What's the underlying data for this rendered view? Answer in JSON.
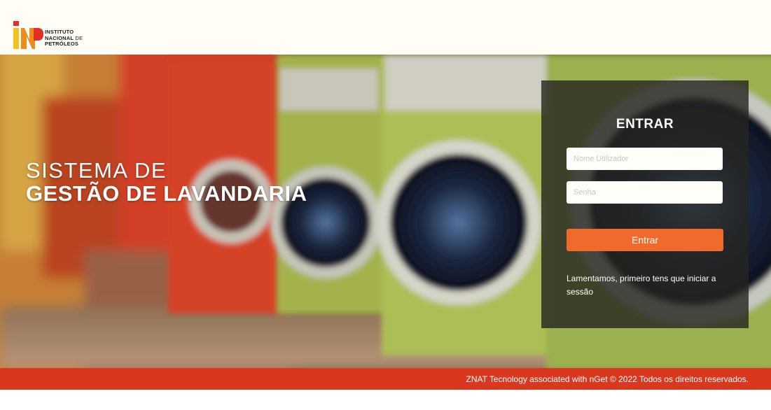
{
  "brand": {
    "line1": "INSTITUTO",
    "line2_bold": "NACIONAL",
    "line2_light": "DE",
    "line3": "PETRÓLEOS"
  },
  "hero": {
    "line1": "SISTEMA DE",
    "line2": "GESTÃO DE LAVANDARIA"
  },
  "login": {
    "title": "ENTRAR",
    "username_placeholder": "Nome Utilizador",
    "username_value": "",
    "password_placeholder": "Senha",
    "password_value": "",
    "submit_label": "Entrar",
    "message": "Lamentamos, primeiro tens que iniciar a sessão"
  },
  "footer": {
    "text": "ZNAT Tecnology associated with nGet © 2022 Todos os direitos reservados."
  },
  "colors": {
    "accent_button": "#ef6a2b",
    "footer_bar": "#d9381e",
    "panel_overlay": "rgba(38,38,32,0.80)"
  }
}
